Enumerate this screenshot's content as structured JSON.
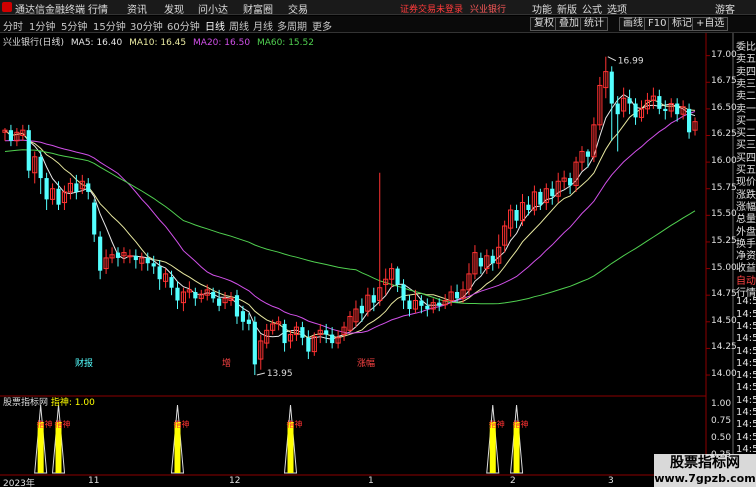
{
  "app": {
    "title": "通达信金融终端",
    "notice": "证券交易未登录"
  },
  "menu": [
    "行情",
    "资讯",
    "发现",
    "问小达",
    "财富圈",
    "交易"
  ],
  "top_right": {
    "stock": "兴业银行",
    "items": [
      "功能",
      "新版",
      "公式",
      "选项",
      "游客"
    ]
  },
  "periods": [
    "分时",
    "1分钟",
    "5分钟",
    "15分钟",
    "30分钟",
    "60分钟",
    "日线",
    "周线",
    "月线",
    "多周期",
    "更多"
  ],
  "active_period": "日线",
  "tools": [
    "复权",
    "叠加",
    "统计",
    "画线",
    "F10",
    "标记",
    "+自选"
  ],
  "chart": {
    "name": "兴业银行(日线)",
    "ma5": "MA5: 16.40",
    "ma10": "MA10: 16.45",
    "ma20": "MA20: 16.50",
    "ma60": "MA60: 15.52",
    "high_label": "16.99",
    "low_label": "13.95"
  },
  "events": [
    "财报",
    "增",
    "涨幅"
  ],
  "indicator": {
    "name": "股票指标网",
    "label": "指神: 1.00",
    "signal_text": "指神",
    "y_ticks": [
      "1.00",
      "0.75",
      "0.50",
      "0.25"
    ]
  },
  "dates": [
    "2023年",
    "11",
    "12",
    "1",
    "2",
    "3"
  ],
  "quote_labels": [
    "委比",
    "卖五",
    "卖四",
    "卖三",
    "卖二",
    "卖一",
    "买一",
    "买二",
    "买三",
    "买四",
    "买五",
    "现价",
    "涨跌",
    "涨幅",
    "总量",
    "外盘",
    "换手",
    "净资",
    "收益",
    "自动",
    "行情",
    "14:5",
    "14:5",
    "14:5",
    "14:5",
    "14:5",
    "14:5",
    "14:5",
    "14:5",
    "14:5",
    "14:5",
    "14:5",
    "14:5",
    "14:5",
    "14:5"
  ],
  "watermark": {
    "name": "股票指标网",
    "url": "www.7gpzb.com"
  },
  "colors": {
    "up": "#ff3232",
    "down": "#54ffff",
    "ma5": "#e8e8e8",
    "ma10": "#e8e8a0",
    "ma20": "#d050e8",
    "ma60": "#50d050",
    "signal": "#ffff00"
  },
  "chart_data": {
    "type": "candlestick",
    "y_ticks": [
      17.0,
      16.75,
      16.5,
      16.25,
      16.0,
      15.75,
      15.5,
      15.25,
      15.0,
      14.75,
      14.5,
      14.25,
      14.0
    ],
    "ylim": [
      13.85,
      17.1
    ],
    "candles": [
      [
        16.28,
        16.3,
        16.2,
        16.32
      ],
      [
        16.3,
        16.2,
        16.15,
        16.35
      ],
      [
        16.2,
        16.28,
        16.15,
        16.32
      ],
      [
        16.25,
        16.3,
        16.2,
        16.35
      ],
      [
        16.3,
        15.92,
        15.85,
        16.35
      ],
      [
        15.9,
        16.05,
        15.8,
        16.1
      ],
      [
        16.05,
        15.85,
        15.7,
        16.1
      ],
      [
        15.85,
        15.65,
        15.55,
        15.9
      ],
      [
        15.65,
        15.75,
        15.6,
        15.8
      ],
      [
        15.75,
        15.6,
        15.55,
        15.82
      ],
      [
        15.62,
        15.72,
        15.55,
        15.78
      ],
      [
        15.72,
        15.8,
        15.65,
        15.85
      ],
      [
        15.8,
        15.72,
        15.65,
        15.88
      ],
      [
        15.75,
        15.82,
        15.7,
        15.88
      ],
      [
        15.8,
        15.72,
        15.65,
        15.85
      ],
      [
        15.62,
        15.32,
        15.25,
        15.65
      ],
      [
        15.3,
        14.98,
        14.9,
        15.35
      ],
      [
        15.0,
        15.1,
        14.95,
        15.18
      ],
      [
        15.1,
        15.13,
        15.05,
        15.2
      ],
      [
        15.15,
        15.1,
        15.02,
        15.2
      ],
      [
        15.12,
        15.15,
        15.05,
        15.2
      ],
      [
        15.12,
        15.12,
        15.05,
        15.18
      ],
      [
        15.12,
        15.08,
        15.0,
        15.18
      ],
      [
        15.05,
        15.1,
        14.98,
        15.15
      ],
      [
        15.1,
        15.05,
        14.98,
        15.15
      ],
      [
        15.05,
        15.02,
        14.95,
        15.12
      ],
      [
        15.02,
        14.9,
        14.8,
        15.08
      ],
      [
        14.88,
        14.95,
        14.82,
        15.0
      ],
      [
        14.92,
        14.82,
        14.75,
        14.98
      ],
      [
        14.82,
        14.7,
        14.62,
        14.88
      ],
      [
        14.68,
        14.78,
        14.6,
        14.82
      ],
      [
        14.78,
        14.8,
        14.72,
        14.88
      ],
      [
        14.78,
        14.72,
        14.65,
        14.82
      ],
      [
        14.72,
        14.76,
        14.68,
        14.8
      ],
      [
        14.75,
        14.8,
        14.7,
        14.85
      ],
      [
        14.78,
        14.72,
        14.68,
        14.82
      ],
      [
        14.72,
        14.65,
        14.6,
        14.8
      ],
      [
        14.68,
        14.72,
        14.62,
        14.78
      ],
      [
        14.7,
        14.72,
        14.65,
        14.78
      ],
      [
        14.75,
        14.55,
        14.48,
        14.8
      ],
      [
        14.6,
        14.5,
        14.42,
        14.65
      ],
      [
        14.52,
        14.48,
        14.42,
        14.58
      ],
      [
        14.5,
        14.1,
        14.0,
        14.55
      ],
      [
        14.15,
        14.32,
        14.05,
        14.38
      ],
      [
        14.3,
        14.42,
        14.25,
        14.48
      ],
      [
        14.42,
        14.48,
        14.38,
        14.52
      ],
      [
        14.48,
        14.5,
        14.42,
        14.55
      ],
      [
        14.48,
        14.3,
        14.22,
        14.52
      ],
      [
        14.32,
        14.38,
        14.25,
        14.42
      ],
      [
        14.38,
        14.45,
        14.32,
        14.5
      ],
      [
        14.45,
        14.35,
        14.28,
        14.5
      ],
      [
        14.35,
        14.22,
        14.15,
        14.42
      ],
      [
        14.22,
        14.36,
        14.18,
        14.4
      ],
      [
        14.38,
        14.42,
        14.3,
        14.48
      ],
      [
        14.42,
        14.38,
        14.3,
        14.48
      ],
      [
        14.38,
        14.3,
        14.25,
        14.45
      ],
      [
        14.3,
        14.35,
        14.25,
        14.42
      ],
      [
        14.38,
        14.45,
        14.32,
        14.5
      ],
      [
        14.42,
        14.55,
        14.4,
        14.6
      ],
      [
        14.5,
        14.62,
        14.45,
        14.7
      ],
      [
        14.65,
        14.58,
        14.5,
        14.72
      ],
      [
        14.6,
        14.75,
        14.55,
        14.82
      ],
      [
        14.75,
        14.68,
        14.6,
        14.82
      ],
      [
        14.7,
        14.82,
        14.65,
        15.9
      ],
      [
        14.85,
        14.9,
        14.75,
        15.0
      ],
      [
        14.9,
        15.0,
        14.82,
        15.05
      ],
      [
        15.0,
        14.85,
        14.78,
        15.02
      ],
      [
        14.85,
        14.7,
        14.62,
        14.9
      ],
      [
        14.7,
        14.62,
        14.55,
        14.75
      ],
      [
        14.62,
        14.7,
        14.58,
        14.8
      ],
      [
        14.7,
        14.65,
        14.58,
        14.75
      ],
      [
        14.65,
        14.62,
        14.55,
        14.72
      ],
      [
        14.62,
        14.68,
        14.58,
        14.72
      ],
      [
        14.68,
        14.65,
        14.6,
        14.72
      ],
      [
        14.66,
        14.7,
        14.62,
        14.76
      ],
      [
        14.7,
        14.78,
        14.65,
        14.84
      ],
      [
        14.78,
        14.72,
        14.68,
        14.85
      ],
      [
        14.72,
        14.8,
        14.68,
        14.88
      ],
      [
        14.8,
        14.95,
        14.75,
        15.05
      ],
      [
        14.95,
        15.15,
        14.9,
        15.22
      ],
      [
        15.1,
        15.02,
        14.95,
        15.15
      ],
      [
        15.0,
        15.12,
        14.95,
        15.18
      ],
      [
        15.12,
        15.05,
        14.98,
        15.18
      ],
      [
        15.05,
        15.2,
        15.0,
        15.32
      ],
      [
        15.22,
        15.4,
        15.15,
        15.45
      ],
      [
        15.38,
        15.55,
        15.3,
        15.6
      ],
      [
        15.55,
        15.45,
        15.38,
        15.6
      ],
      [
        15.45,
        15.62,
        15.4,
        15.7
      ],
      [
        15.6,
        15.55,
        15.5,
        15.68
      ],
      [
        15.55,
        15.72,
        15.5,
        15.78
      ],
      [
        15.72,
        15.6,
        15.55,
        15.75
      ],
      [
        15.62,
        15.75,
        15.55,
        15.8
      ],
      [
        15.75,
        15.68,
        15.6,
        15.82
      ],
      [
        15.68,
        15.82,
        15.62,
        15.9
      ],
      [
        15.82,
        15.85,
        15.75,
        15.92
      ],
      [
        15.85,
        15.78,
        15.7,
        15.9
      ],
      [
        15.78,
        16.0,
        15.72,
        16.05
      ],
      [
        16.0,
        16.1,
        15.92,
        16.15
      ],
      [
        16.1,
        16.05,
        15.95,
        16.12
      ],
      [
        16.05,
        16.35,
        16.0,
        16.42
      ],
      [
        16.35,
        16.72,
        16.3,
        16.8
      ],
      [
        16.7,
        16.85,
        16.6,
        16.99
      ],
      [
        16.85,
        16.55,
        16.2,
        16.9
      ],
      [
        16.55,
        16.45,
        16.1,
        16.62
      ],
      [
        16.48,
        16.6,
        16.42,
        16.7
      ],
      [
        16.6,
        16.55,
        16.45,
        16.68
      ],
      [
        16.55,
        16.42,
        16.35,
        16.6
      ],
      [
        16.42,
        16.5,
        16.38,
        16.58
      ],
      [
        16.5,
        16.58,
        16.45,
        16.65
      ],
      [
        16.58,
        16.62,
        16.5,
        16.7
      ],
      [
        16.62,
        16.5,
        16.45,
        16.68
      ],
      [
        16.5,
        16.48,
        16.4,
        16.58
      ],
      [
        16.48,
        16.55,
        16.42,
        16.6
      ],
      [
        16.55,
        16.45,
        16.38,
        16.6
      ],
      [
        16.45,
        16.52,
        16.4,
        16.58
      ],
      [
        16.5,
        16.28,
        16.22,
        16.55
      ],
      [
        16.3,
        16.38,
        16.25,
        16.42
      ]
    ],
    "indicator_signals": [
      6,
      9,
      29,
      48,
      82,
      86,
      131
    ]
  }
}
